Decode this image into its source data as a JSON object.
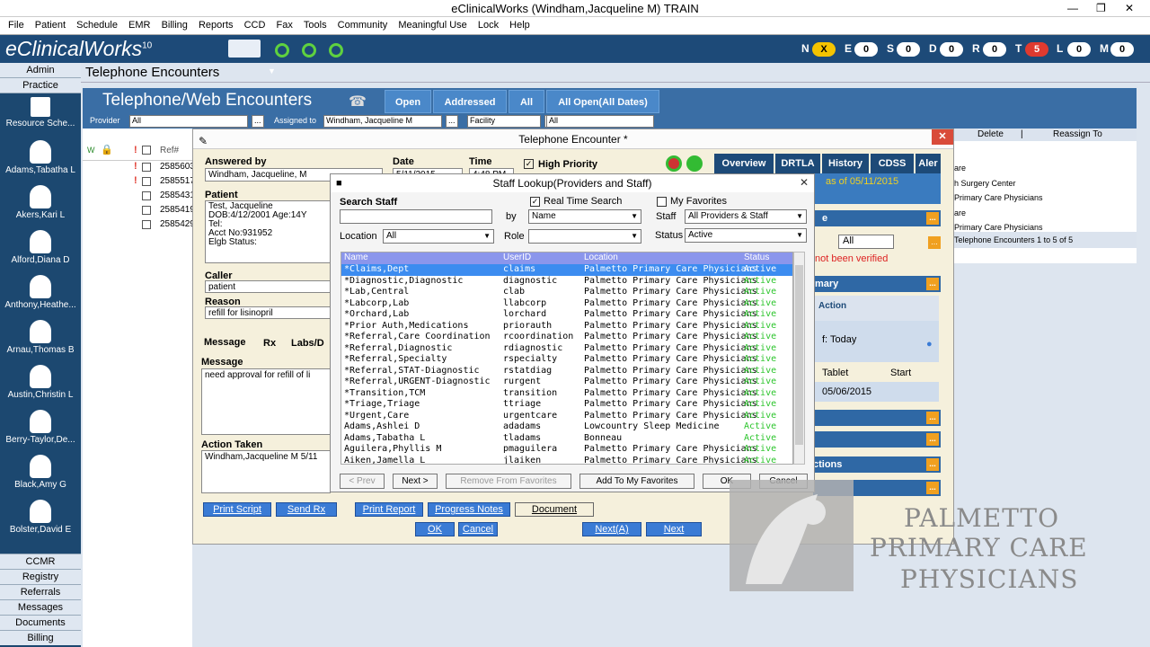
{
  "window": {
    "title": "eClinicalWorks (Windham,Jacqueline M)  TRAIN"
  },
  "menu": [
    "File",
    "Patient",
    "Schedule",
    "EMR",
    "Billing",
    "Reports",
    "CCD",
    "Fax",
    "Tools",
    "Community",
    "Meaningful Use",
    "Lock",
    "Help"
  ],
  "brand": {
    "logo": "eClinicalWorks",
    "version": "10"
  },
  "status_counters": [
    {
      "letter": "N",
      "value": "X",
      "color": "#f5c400"
    },
    {
      "letter": "E",
      "value": "0",
      "color": "#ffffff"
    },
    {
      "letter": "S",
      "value": "0",
      "color": "#ffffff"
    },
    {
      "letter": "D",
      "value": "0",
      "color": "#ffffff"
    },
    {
      "letter": "R",
      "value": "0",
      "color": "#ffffff"
    },
    {
      "letter": "T",
      "value": "5",
      "color": "#e03a2f"
    },
    {
      "letter": "L",
      "value": "0",
      "color": "#ffffff"
    },
    {
      "letter": "M",
      "value": "0",
      "color": "#ffffff"
    }
  ],
  "sidebar": {
    "top": [
      "Admin",
      "Practice"
    ],
    "resource": "Resource Sche...",
    "providers": [
      "Adams,Tabatha L",
      "Akers,Kari L",
      "Alford,Diana D",
      "Anthony,Heathe...",
      "Arnau,Thomas B",
      "Austin,Christin L",
      "Berry-Taylor,De...",
      "Black,Amy G",
      "Bolster,David E"
    ],
    "bottom": [
      "CCMR",
      "Registry",
      "Referrals",
      "Messages",
      "Documents",
      "Billing"
    ]
  },
  "page_header": "Telephone Encounters",
  "twe": {
    "title": "Telephone/Web Encounters",
    "tabs": [
      "Open",
      "Addressed",
      "All",
      "All Open(All Dates)"
    ],
    "filters": {
      "provider_label": "Provider",
      "provider_value": "All",
      "assigned_label": "Assigned to",
      "assigned_value": "Windham, Jacqueline M",
      "facility_value": "Facility",
      "last_value": "All"
    }
  },
  "grid": {
    "headers": [
      "W",
      "Ref#"
    ],
    "refs": [
      "2585603",
      "2585517",
      "2585431",
      "2585419",
      "2585429"
    ]
  },
  "right_grid": {
    "headers": [
      "Delete",
      "Reassign To"
    ],
    "rows": [
      "are",
      "h Surgery Center",
      "Primary Care Physicians",
      "are",
      "Primary Care Physicians"
    ],
    "footer": "Telephone Encounters 1 to 5 of 5"
  },
  "encounter": {
    "title": "Telephone Encounter *",
    "answered_by_label": "Answered by",
    "answered_by": "Windham, Jacqueline, M",
    "date_label": "Date",
    "date": "5/11/2015",
    "time_label": "Time",
    "time": "4:48 PM",
    "high_priority": "High Priority",
    "patient_label": "Patient",
    "patient_lines": [
      "Test, Jacqueline",
      "DOB:4/12/2001  Age:14Y",
      "Tel:",
      "Acct No:931952",
      "Elgb Status:"
    ],
    "caller_label": "Caller",
    "caller": "patient",
    "reason_label": "Reason",
    "reason": "refill for lisinopril",
    "msg_tabs": [
      "Message",
      "Rx",
      "Labs/D"
    ],
    "message_label": "Message",
    "message": "need approval for refill of li",
    "action_label": "Action Taken",
    "action": "Windham,Jacqueline M 5/11",
    "right_tabs": [
      "Overview",
      "DRTLA",
      "History",
      "CDSS",
      "Aler"
    ],
    "as_of": "as of 05/11/2015",
    "not_verified": "not been verified",
    "all_select": "All",
    "mary": "mary",
    "action_col": "Action",
    "today": "f: Today",
    "tablet": "Tablet",
    "start": "Start",
    "tdate": "05/06/2015",
    "actions": "ctions",
    "bottom_buttons": [
      "Print Script",
      "Send Rx",
      "Print Report",
      "Progress Notes",
      "Document"
    ],
    "ok": "OK",
    "cancel": "Cancel",
    "next_a": "Next(A)",
    "next": "Next"
  },
  "lookup": {
    "title": "Staff Lookup(Providers and Staff)",
    "search_label": "Search Staff",
    "by_label": "by",
    "by_value": "Name",
    "realtime": "Real Time Search",
    "favorites": "My Favorites",
    "staff_label": "Staff",
    "staff_value": "All Providers & Staff",
    "location_label": "Location",
    "location_value": "All",
    "role_label": "Role",
    "role_value": "",
    "status_label": "Status",
    "status_value": "Active",
    "columns": [
      "Name",
      "UserID",
      "Location",
      "Status"
    ],
    "rows": [
      [
        "*Claims,Dept",
        "claims",
        "Palmetto Primary Care Physicians",
        "Active"
      ],
      [
        "*Diagnostic,Diagnostic",
        "diagnostic",
        "Palmetto Primary Care Physicians",
        "Active"
      ],
      [
        "*Lab,Central",
        "clab",
        "Palmetto Primary Care Physicians",
        "Active"
      ],
      [
        "*Labcorp,Lab",
        "llabcorp",
        "Palmetto Primary Care Physicians",
        "Active"
      ],
      [
        "*Orchard,Lab",
        "lorchard",
        "Palmetto Primary Care Physicians",
        "Active"
      ],
      [
        "*Prior Auth,Medications",
        "priorauth",
        "Palmetto Primary Care Physicians",
        "Active"
      ],
      [
        "*Referral,Care Coordination",
        "rcoordination",
        "Palmetto Primary Care Physicians",
        "Active"
      ],
      [
        "*Referral,Diagnostic",
        "rdiagnostic",
        "Palmetto Primary Care Physicians",
        "Active"
      ],
      [
        "*Referral,Specialty",
        "rspecialty",
        "Palmetto Primary Care Physicians",
        "Active"
      ],
      [
        "*Referral,STAT-Diagnostic",
        "rstatdiag",
        "Palmetto Primary Care Physicians",
        "Active"
      ],
      [
        "*Referral,URGENT-Diagnostic",
        "rurgent",
        "Palmetto Primary Care Physicians",
        "Active"
      ],
      [
        "*Transition,TCM",
        "transition",
        "Palmetto Primary Care Physicians",
        "Active"
      ],
      [
        "*Triage,Triage",
        "ttriage",
        "Palmetto Primary Care Physicians",
        "Active"
      ],
      [
        "*Urgent,Care",
        "urgentcare",
        "Palmetto Primary Care Physicians",
        "Active"
      ],
      [
        "Adams,Ashlei D",
        "adadams",
        "Lowcountry Sleep Medicine",
        "Active"
      ],
      [
        "Adams,Tabatha L",
        "tladams",
        "Bonneau",
        "Active"
      ],
      [
        "Aguilera,Phyllis M",
        "pmaguilera",
        "Palmetto Primary Care Physicians",
        "Active"
      ],
      [
        "Aiken,Jamella L",
        "jlaiken",
        "Palmetto Primary Care Physicians",
        "Active"
      ]
    ],
    "buttons": {
      "prev": "< Prev",
      "next": "Next >",
      "remove": "Remove From Favorites",
      "add": "Add To My Favorites",
      "ok": "OK",
      "cancel": "Cancel"
    }
  },
  "watermark": [
    "PALMETTO",
    "PRIMARY CARE",
    "PHYSICIANS"
  ]
}
